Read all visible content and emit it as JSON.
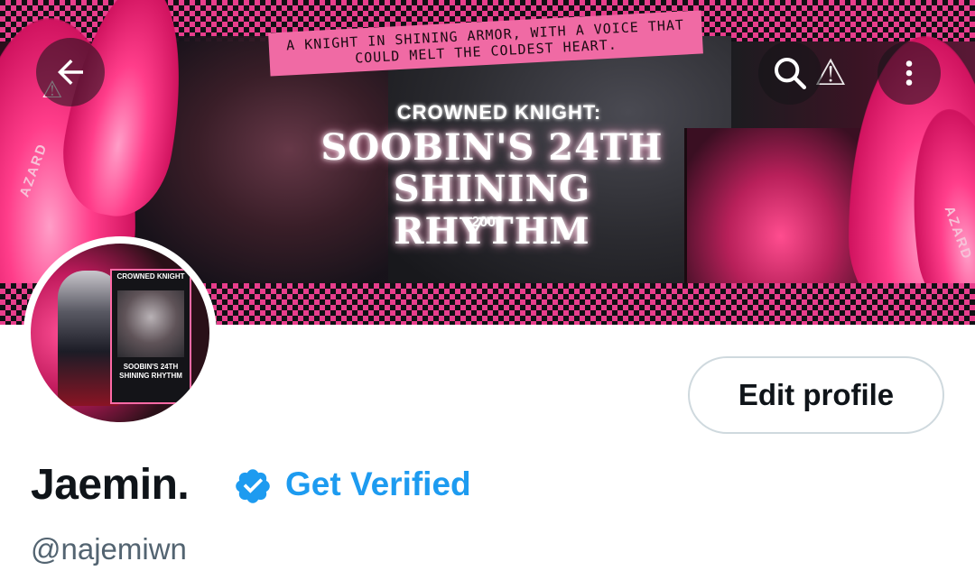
{
  "banner": {
    "tagline": "A KNIGHT IN SHINING ARMOR, WITH A VOICE THAT COULD MELT THE COLDEST HEART.",
    "subtitle": "CROWNED KNIGHT:",
    "title_line1": "SOOBIN'S 24TH",
    "title_line2": "SHINING RHYTHM",
    "year": "2000",
    "side_text_left": "AZARD",
    "side_text_right": "AZARD"
  },
  "nav": {
    "back_icon": "back-arrow-icon",
    "search_icon": "search-icon",
    "more_icon": "more-vertical-icon"
  },
  "avatar": {
    "card_title": "CROWNED KNIGHT",
    "card_line1": "SOOBIN'S 24TH",
    "card_line2": "SHINING RHYTHM"
  },
  "profile": {
    "edit_label": "Edit profile",
    "name": "Jaemin.",
    "get_verified_label": "Get Verified",
    "handle": "@najemiwn"
  },
  "colors": {
    "accent_blue": "#1d9bf0",
    "text_primary": "#0f1419",
    "text_secondary": "#536471",
    "banner_pink": "#e83e8c"
  }
}
